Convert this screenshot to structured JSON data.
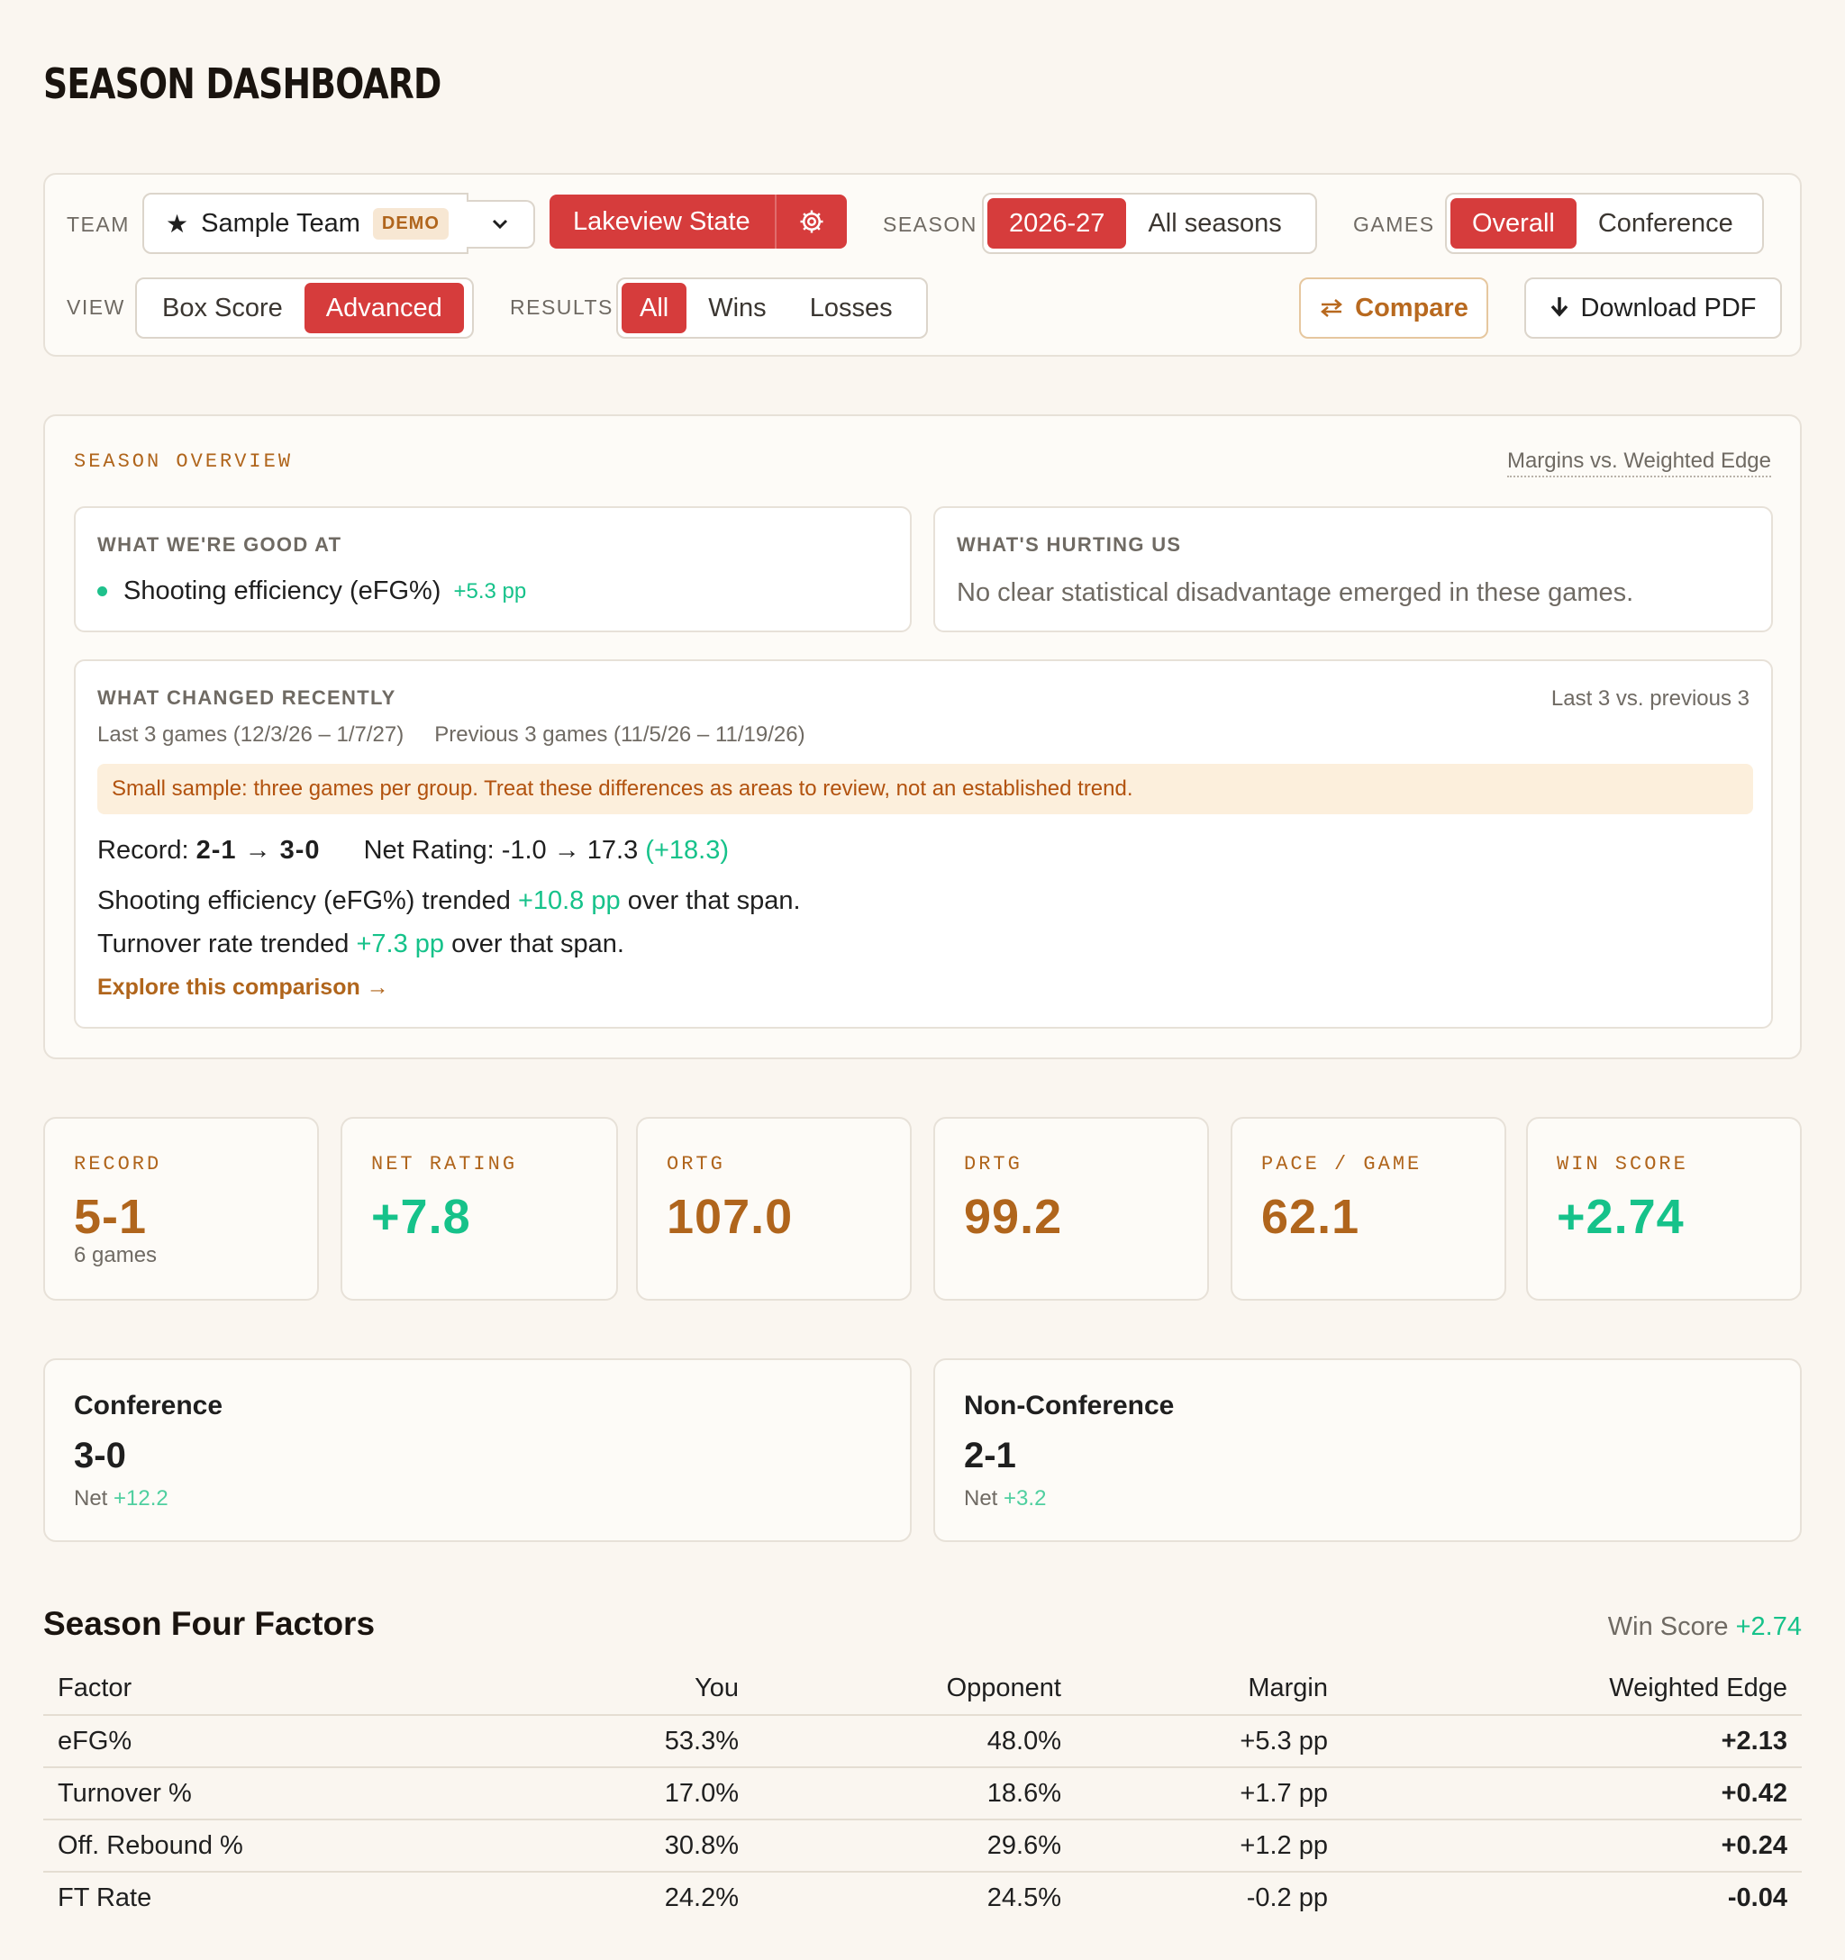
{
  "page": {
    "title": "SEASON DASHBOARD"
  },
  "filters": {
    "team_label": "TEAM",
    "team_value": "Sample Team",
    "team_badge": "DEMO",
    "team_pill": "Lakeview State",
    "season_label": "SEASON",
    "season_options": [
      "2026-27",
      "All seasons"
    ],
    "games_label": "GAMES",
    "games_options": [
      "Overall",
      "Conference"
    ],
    "view_label": "VIEW",
    "view_options": [
      "Box Score",
      "Advanced"
    ],
    "results_label": "RESULTS",
    "results_options": [
      "All",
      "Wins",
      "Losses"
    ],
    "compare_label": "Compare",
    "download_label": "Download PDF"
  },
  "overview": {
    "label": "SEASON OVERVIEW",
    "link": "Margins vs. Weighted Edge",
    "good": {
      "heading": "WHAT WE'RE GOOD AT",
      "item": "Shooting efficiency (eFG%)",
      "value": "+5.3 pp"
    },
    "hurting": {
      "heading": "WHAT'S HURTING US",
      "text": "No clear statistical disadvantage emerged in these games."
    },
    "changed": {
      "heading": "WHAT CHANGED RECENTLY",
      "note": "Last 3 vs. previous 3",
      "range_last": "Last 3 games (12/3/26 – 1/7/27)",
      "range_prev": "Previous 3 games (11/5/26 – 11/19/26)",
      "warning": "Small sample: three games per group. Treat these differences as areas to review, not an established trend.",
      "record_label": "Record:",
      "record_value": "2-1 → 3-0",
      "net_label": "Net Rating:",
      "net_value": "-1.0 → 17.3",
      "net_delta": "(+18.3)",
      "trend1_pre": "Shooting efficiency (eFG%) trended",
      "trend1_val": "+10.8 pp",
      "trend1_post": "over that span.",
      "trend2_pre": "Turnover rate trended",
      "trend2_val": "+7.3 pp",
      "trend2_post": "over that span.",
      "explore": "Explore this comparison →"
    }
  },
  "stats": [
    {
      "label": "RECORD",
      "value": "5-1",
      "sub": "6 games"
    },
    {
      "label": "NET RATING",
      "value": "+7.8"
    },
    {
      "label": "ORTG",
      "value": "107.0"
    },
    {
      "label": "DRTG",
      "value": "99.2"
    },
    {
      "label": "PACE / GAME",
      "value": "62.1"
    },
    {
      "label": "WIN SCORE",
      "value": "+2.74"
    }
  ],
  "splits": [
    {
      "title": "Conference",
      "record": "3-0",
      "net_label": "Net",
      "net_value": "+12.2"
    },
    {
      "title": "Non-Conference",
      "record": "2-1",
      "net_label": "Net",
      "net_value": "+3.2"
    }
  ],
  "four_factors": {
    "title": "Season Four Factors",
    "win_score_label": "Win Score",
    "win_score_value": "+2.74",
    "columns": [
      "Factor",
      "You",
      "Opponent",
      "Margin",
      "Weighted Edge"
    ],
    "rows": [
      [
        "eFG%",
        "53.3%",
        "48.0%",
        "+5.3 pp",
        "+2.13"
      ],
      [
        "Turnover %",
        "17.0%",
        "18.6%",
        "+1.7 pp",
        "+0.42"
      ],
      [
        "Off. Rebound %",
        "30.8%",
        "29.6%",
        "+1.2 pp",
        "+0.24"
      ],
      [
        "FT Rate",
        "24.2%",
        "24.5%",
        "-0.2 pp",
        "-0.04"
      ]
    ]
  },
  "colors": {
    "accent_red": "#d63c3c",
    "accent_orange": "#b0651c",
    "positive": "#16c28a",
    "negative": "#ec5a72",
    "background": "#faf6f0"
  }
}
